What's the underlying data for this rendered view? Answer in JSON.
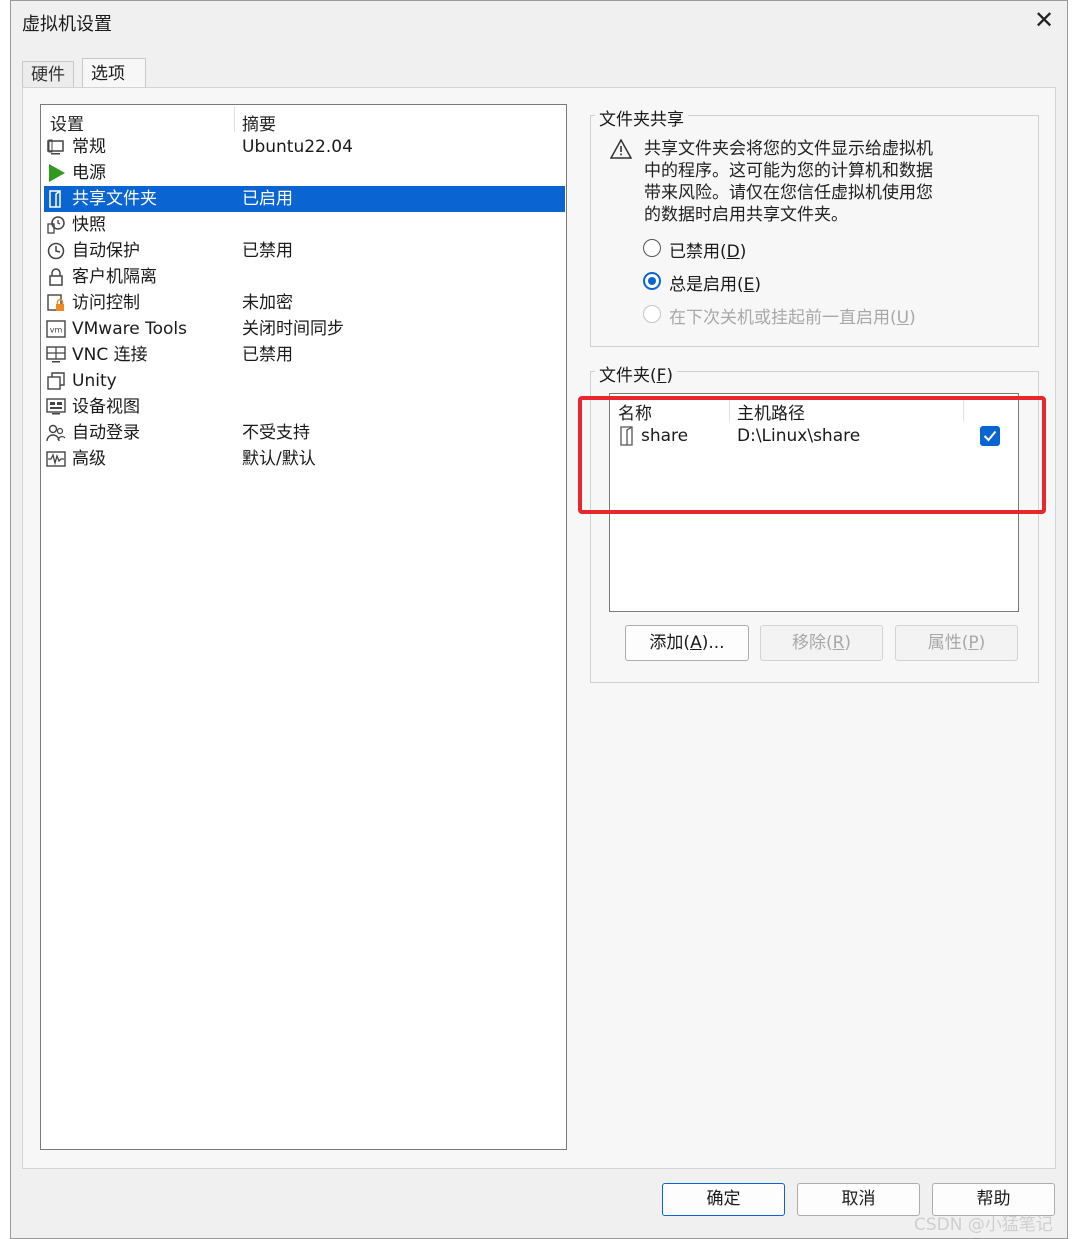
{
  "window": {
    "title": "虚拟机设置"
  },
  "tabs": [
    {
      "label": "硬件"
    },
    {
      "label": "选项"
    }
  ],
  "settings_list": {
    "columns": [
      "设置",
      "摘要"
    ],
    "items": [
      {
        "name": "常规",
        "summary": "Ubuntu22.04",
        "icon": "monitor-icon"
      },
      {
        "name": "电源",
        "summary": "",
        "icon": "play-icon"
      },
      {
        "name": "共享文件夹",
        "summary": "已启用",
        "icon": "shared-folder-icon",
        "selected": true
      },
      {
        "name": "快照",
        "summary": "",
        "icon": "snapshot-icon"
      },
      {
        "name": "自动保护",
        "summary": "已禁用",
        "icon": "clock-icon"
      },
      {
        "name": "客户机隔离",
        "summary": "",
        "icon": "lock-icon"
      },
      {
        "name": "访问控制",
        "summary": "未加密",
        "icon": "access-control-icon"
      },
      {
        "name": "VMware Tools",
        "summary": "关闭时间同步",
        "icon": "vm-icon"
      },
      {
        "name": "VNC 连接",
        "summary": "已禁用",
        "icon": "vnc-icon"
      },
      {
        "name": "Unity",
        "summary": "",
        "icon": "unity-icon"
      },
      {
        "name": "设备视图",
        "summary": "",
        "icon": "device-view-icon"
      },
      {
        "name": "自动登录",
        "summary": "不受支持",
        "icon": "users-icon"
      },
      {
        "name": "高级",
        "summary": "默认/默认",
        "icon": "waveform-icon"
      }
    ]
  },
  "folder_sharing": {
    "group_label": "文件夹共享",
    "info": "共享文件夹会将您的文件显示给虚拟机中的程序。这可能为您的计算机和数据带来风险。请仅在您信任虚拟机使用您的数据时启用共享文件夹。",
    "info_lines": [
      "共享文件夹会将您的文件显示给虚拟机",
      "中的程序。这可能为您的计算机和数据",
      "带来风险。请仅在您信任虚拟机使用您",
      "的数据时启用共享文件夹。"
    ],
    "options": [
      {
        "label": "已禁用",
        "key": "D",
        "state": "off"
      },
      {
        "label": "总是启用",
        "key": "E",
        "state": "on"
      },
      {
        "label": "在下次关机或挂起前一直启用",
        "key": "U",
        "state": "disabled"
      }
    ]
  },
  "folders": {
    "group_label": "文件夹",
    "group_key": "F",
    "columns": [
      "名称",
      "主机路径"
    ],
    "rows": [
      {
        "name": "share",
        "path": "D:\\Linux\\share",
        "enabled": true
      }
    ],
    "buttons": [
      {
        "label": "添加",
        "key": "A",
        "suffix": "...",
        "enabled": true
      },
      {
        "label": "移除",
        "key": "R",
        "suffix": "",
        "enabled": false
      },
      {
        "label": "属性",
        "key": "P",
        "suffix": "",
        "enabled": false
      }
    ]
  },
  "footer_buttons": {
    "ok": "确定",
    "cancel": "取消",
    "help": "帮助"
  },
  "watermark": "CSDN @小猛笔记",
  "colors": {
    "selection": "#0a64d1",
    "highlight_box": "#e8262c"
  }
}
